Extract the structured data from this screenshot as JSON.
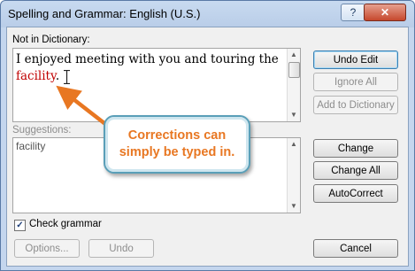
{
  "window": {
    "title": "Spelling and Grammar: English (U.S.)",
    "help_glyph": "?",
    "close_glyph": "✕"
  },
  "not_in_dictionary": {
    "label": "Not in Dictionary:",
    "text_before": "I enjoyed meeting with you and touring the ",
    "misspelled": "facility",
    "text_after": "."
  },
  "suggestions": {
    "label": "Suggestions:",
    "items": [
      "facility"
    ]
  },
  "buttons": {
    "undo_edit": "Undo Edit",
    "ignore_all": "Ignore All",
    "add_to_dictionary": "Add to Dictionary",
    "change": "Change",
    "change_all": "Change All",
    "autocorrect": "AutoCorrect",
    "options": "Options...",
    "undo": "Undo",
    "cancel": "Cancel"
  },
  "check_grammar": {
    "label": "Check grammar",
    "checked": true
  },
  "callout": {
    "line1": "Corrections can",
    "line2": "simply be typed in."
  },
  "colors": {
    "callout_text": "#e87722",
    "arrow": "#e87722",
    "callout_border": "#5a9fb8"
  }
}
